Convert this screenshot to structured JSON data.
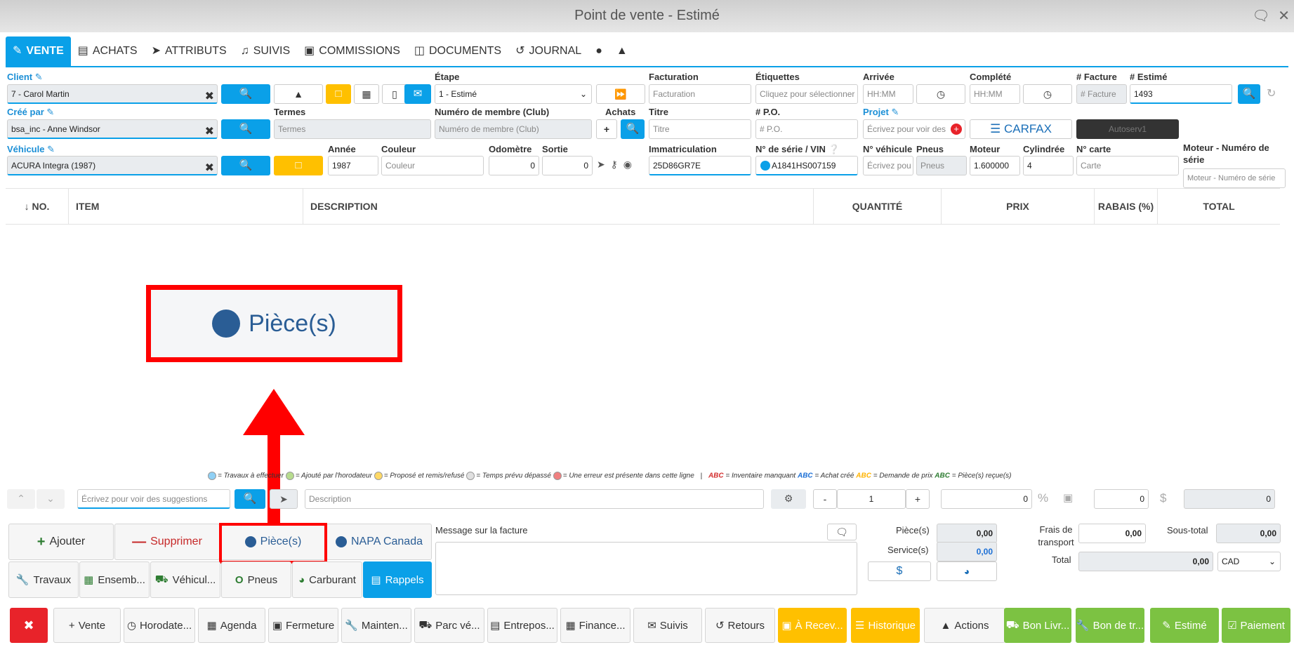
{
  "window": {
    "title": "Point de vente - Estimé"
  },
  "tabs": [
    {
      "label": "VENTE",
      "icon": "edit-icon"
    },
    {
      "label": "ACHATS",
      "icon": "card-icon"
    },
    {
      "label": "ATTRIBUTS",
      "icon": "tag-icon"
    },
    {
      "label": "SUIVIS",
      "icon": "bell-icon"
    },
    {
      "label": "COMMISSIONS",
      "icon": "money-icon"
    },
    {
      "label": "DOCUMENTS",
      "icon": "folder-icon"
    },
    {
      "label": "JOURNAL",
      "icon": "history-icon"
    }
  ],
  "labels": {
    "client": "Client",
    "etape": "Étape",
    "facturation": "Facturation",
    "etiquettes": "Étiquettes",
    "arrivee": "Arrivée",
    "complete": "Complété",
    "facture": "# Facture",
    "estime": "# Estimé",
    "cree_par": "Créé par",
    "termes": "Termes",
    "membre": "Numéro de membre (Club)",
    "achats": "Achats",
    "titre": "Titre",
    "po": "# P.O.",
    "projet": "Projet",
    "vehicule": "Véhicule",
    "annee": "Année",
    "couleur": "Couleur",
    "odometre": "Odomètre",
    "sortie": "Sortie",
    "immatriculation": "Immatriculation",
    "vin": "N° de série / VIN",
    "no_vehicule": "N° véhicule",
    "pneus": "Pneus",
    "moteur": "Moteur",
    "cylindree": "Cylindrée",
    "no_carte": "N° carte",
    "moteur_serie": "Moteur - Numéro de série"
  },
  "fields": {
    "client": "7 - Carol Martin",
    "etape": "1 - Estimé",
    "facturation_ph": "Facturation",
    "etiquettes_ph": "Cliquez pour sélectionner",
    "arrivee_ph": "HH:MM",
    "complete_ph": "HH:MM",
    "facture_ph": "# Facture",
    "estime": "1493",
    "cree_par": "bsa_inc - Anne Windsor",
    "termes_ph": "Termes",
    "membre_ph": "Numéro de membre (Club)",
    "titre_ph": "Titre",
    "po_ph": "# P.O.",
    "projet_ph": "Écrivez pour voir des",
    "carfax": "CARFAX",
    "autoserv": "Autoserv1",
    "vehicule": "ACURA Integra (1987)",
    "annee": "1987",
    "couleur_ph": "Couleur",
    "odometre": "0",
    "sortie": "0",
    "immatriculation": "25D86GR7E",
    "vin": "A1841HS007159",
    "no_vehicule_ph": "Écrivez pou",
    "pneus_ph": "Pneus",
    "moteur": "1.600000",
    "cylindree": "4",
    "carte_ph": "Carte",
    "moteur_serie_ph": "Moteur - Numéro de série"
  },
  "table": {
    "headers": [
      "↓ NO.",
      "ITEM",
      "DESCRIPTION",
      "QUANTITÉ",
      "PRIX",
      "RABAIS (%)",
      "TOTAL"
    ]
  },
  "callout": {
    "label": "Pièce(s)"
  },
  "legend": {
    "a": "= Travaux à effectuer",
    "b": "= Ajouté par l'horodateur",
    "c": "= Proposé et remis/refusé",
    "d": "= Temps prévu dépassé",
    "e": "= Une erreur est présente dans cette ligne",
    "sep": "|",
    "abc": "ABC",
    "f": "= Inventaire manquant",
    "g": "= Achat créé",
    "h": "= Demande de prix",
    "i": "= Pièce(s) reçue(s)"
  },
  "entry": {
    "suggest_ph": "Écrivez pour voir des suggestions",
    "desc_ph": "Description",
    "qty": "1",
    "minus": "-",
    "plus": "+",
    "price": "0",
    "pct": "%",
    "rabais": "0",
    "dollar": "$",
    "total": "0"
  },
  "actions": {
    "ajouter": "Ajouter",
    "supprimer": "Supprimer",
    "pieces": "Pièce(s)",
    "napa": "NAPA Canada",
    "travaux": "Travaux",
    "ensemb": "Ensemb...",
    "vehicul": "Véhicul...",
    "pneus": "Pneus",
    "carburant": "Carburant",
    "rappels": "Rappels"
  },
  "message": {
    "label": "Message sur la facture"
  },
  "totals": {
    "pieces_label": "Pièce(s)",
    "pieces": "0,00",
    "service_label": "Service(s)",
    "service": "0,00",
    "dollar": "$",
    "frais_label": "Frais de transport",
    "frais": "0,00",
    "soustotal_label": "Sous-total",
    "soustotal": "0,00",
    "total_label": "Total",
    "total": "0,00",
    "currency": "CAD"
  },
  "bottom": [
    {
      "label": "",
      "style": "red",
      "icon": "close-icon"
    },
    {
      "label": "Vente",
      "style": "",
      "icon": "plus-icon"
    },
    {
      "label": "Horodate...",
      "style": "",
      "icon": "clock-icon"
    },
    {
      "label": "Agenda",
      "style": "",
      "icon": "calendar-icon"
    },
    {
      "label": "Fermeture",
      "style": "",
      "icon": "lock-icon"
    },
    {
      "label": "Mainten...",
      "style": "",
      "icon": "wrench-icon"
    },
    {
      "label": "Parc vé...",
      "style": "",
      "icon": "car-icon"
    },
    {
      "label": "Entrepos...",
      "style": "",
      "icon": "archive-icon"
    },
    {
      "label": "Finance...",
      "style": "",
      "icon": "calculator-icon"
    },
    {
      "label": "Suivis",
      "style": "",
      "icon": "mail-icon"
    },
    {
      "label": "Retours",
      "style": "",
      "icon": "undo-icon"
    },
    {
      "label": "À Recev...",
      "style": "orange",
      "icon": "money-icon"
    },
    {
      "label": "Historique",
      "style": "orange",
      "icon": "list-icon"
    },
    {
      "label": "Actions",
      "style": "",
      "icon": "caret-up-icon"
    },
    {
      "label": "Bon Livr...",
      "style": "green",
      "icon": "truck-icon"
    },
    {
      "label": "Bon de tr...",
      "style": "green",
      "icon": "wrench-icon"
    },
    {
      "label": "Estimé",
      "style": "green",
      "icon": "edit-icon"
    },
    {
      "label": "Paiement",
      "style": "green",
      "icon": "check-icon"
    }
  ],
  "colors": {
    "accent": "#0aa0e8",
    "warning": "#ffc000",
    "success": "#7cc242",
    "danger": "#e8232a",
    "annotation": "#ff0000"
  }
}
